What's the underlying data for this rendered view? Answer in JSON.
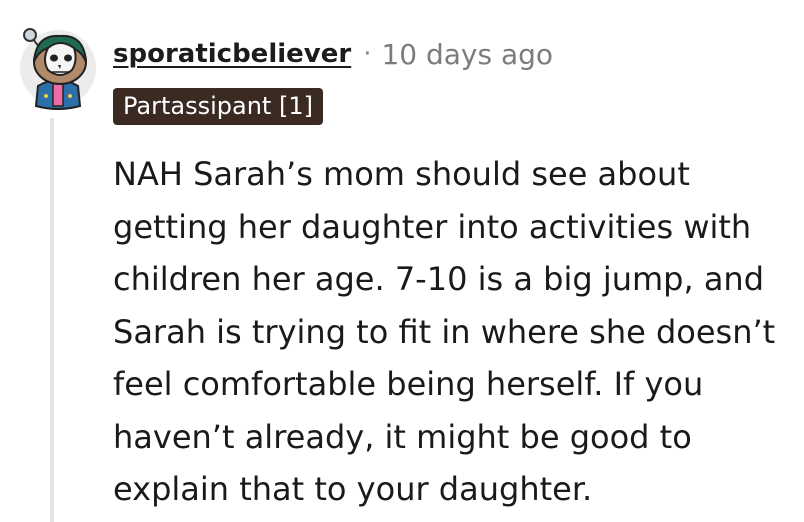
{
  "comment": {
    "username": "sporaticbeliever",
    "separator": "·",
    "timestamp": "10 days ago",
    "flair": "Partassipant [1]",
    "body": "NAH Sarah’s mom should see about getting her daughter into activities with children her age. 7-10 is a big jump, and Sarah is trying to fit in where she doesn’t feel comfortable being herself. If you haven’t already, it might be good to explain that to your daughter.",
    "avatar_icon": "snoo-avatar-icon"
  },
  "colors": {
    "flair_background": "#3b2a22",
    "flair_text": "#ffffff",
    "timestamp": "#7c7c7c",
    "thread_line": "#e4e4e4"
  }
}
